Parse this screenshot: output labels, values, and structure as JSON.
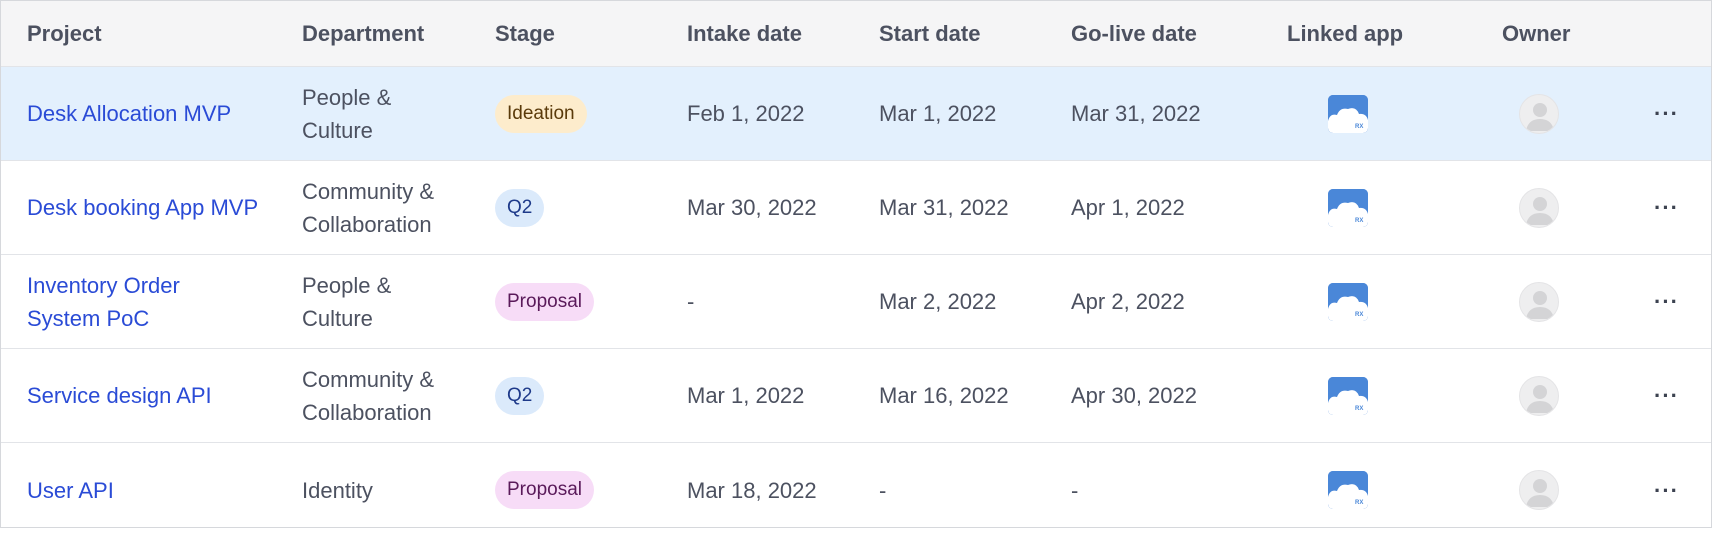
{
  "columns": {
    "project": "Project",
    "department": "Department",
    "stage": "Stage",
    "intake": "Intake date",
    "start": "Start date",
    "golive": "Go-live date",
    "linked_app": "Linked app",
    "owner": "Owner"
  },
  "rows": [
    {
      "project_line1": "Desk Allocation MVP",
      "project_line2": "",
      "dept_line1": "People &",
      "dept_line2": "Culture",
      "stage": "Ideation",
      "intake": "Feb 1, 2022",
      "start": "Mar 1, 2022",
      "golive": "Mar 31, 2022"
    },
    {
      "project_line1": "Desk booking App MVP",
      "project_line2": "",
      "dept_line1": "Community &",
      "dept_line2": "Collaboration",
      "stage": "Q2",
      "intake": "Mar 30, 2022",
      "start": "Mar 31, 2022",
      "golive": "Apr 1, 2022"
    },
    {
      "project_line1": "Inventory Order",
      "project_line2": "System PoC",
      "dept_line1": "People &",
      "dept_line2": "Culture",
      "stage": "Proposal",
      "intake": "-",
      "start": "Mar 2, 2022",
      "golive": "Apr 2, 2022"
    },
    {
      "project_line1": "Service design API",
      "project_line2": "",
      "dept_line1": "Community &",
      "dept_line2": "Collaboration",
      "stage": "Q2",
      "intake": "Mar 1, 2022",
      "start": "Mar 16, 2022",
      "golive": "Apr 30, 2022"
    },
    {
      "project_line1": "User API",
      "project_line2": "",
      "dept_line1": "Identity",
      "dept_line2": "",
      "stage": "Proposal",
      "intake": "Mar 18, 2022",
      "start": "-",
      "golive": "-"
    }
  ],
  "app_icon_label": "RX",
  "more_label": "···",
  "colors": {
    "link": "#2a4bd6",
    "selected_row": "#e3f0fd",
    "header_bg": "#f5f5f6",
    "ideation_badge": "#fdeccc",
    "q2_badge": "#dbeafb",
    "proposal_badge": "#f7dcf7",
    "app_icon": "#4a87d8"
  }
}
